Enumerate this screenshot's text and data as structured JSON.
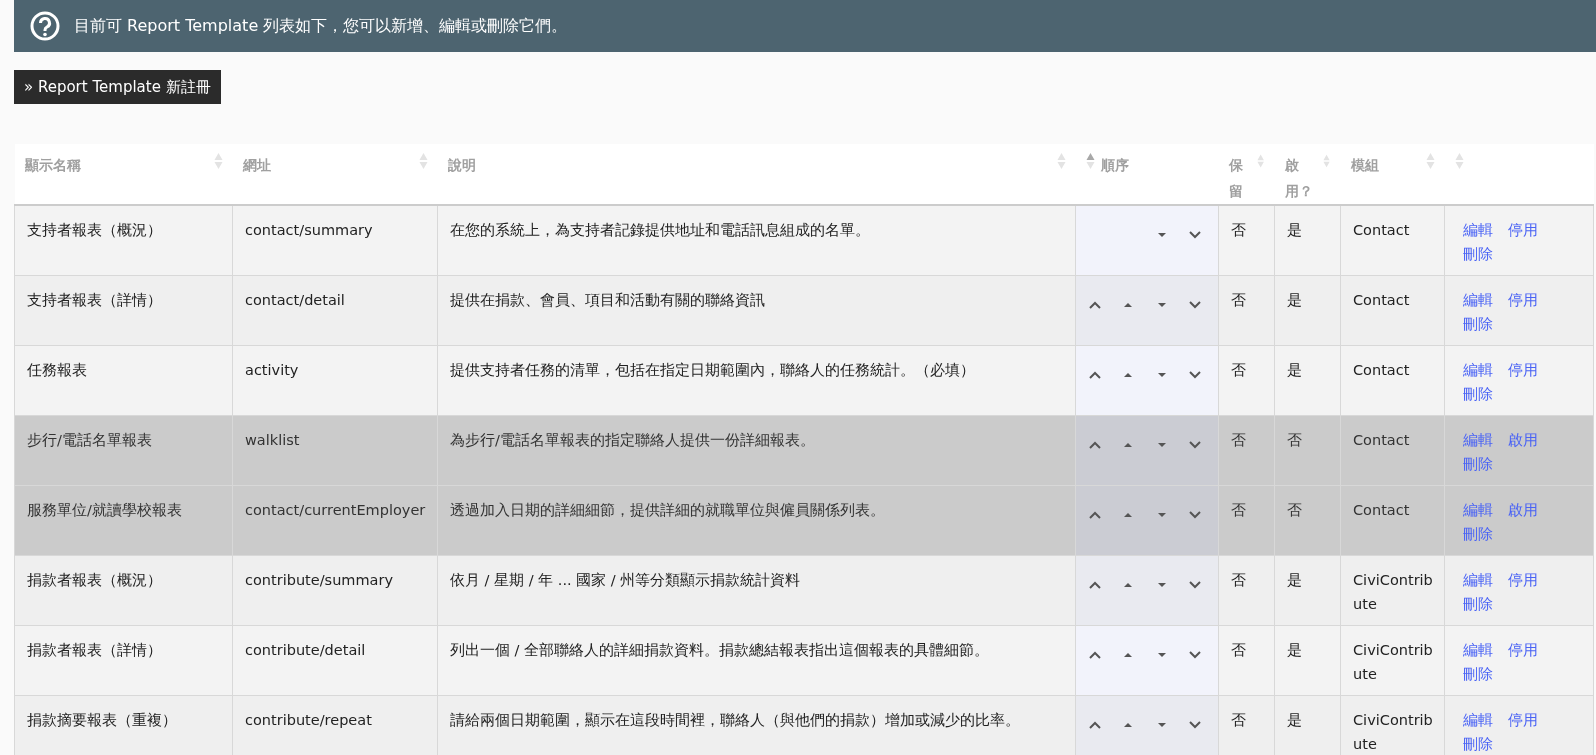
{
  "banner": {
    "text": "目前可 Report Template 列表如下，您可以新增、編輯或刪除它們。"
  },
  "new_button": {
    "label": "» Report Template 新註冊"
  },
  "table": {
    "columns": [
      {
        "label": "顯示名稱",
        "sorted": false
      },
      {
        "label": "網址",
        "sorted": false
      },
      {
        "label": "說明",
        "sorted": false
      },
      {
        "label": "順序",
        "sorted": true
      },
      {
        "label": "保留",
        "sorted": false
      },
      {
        "label": "啟用？",
        "sorted": false
      },
      {
        "label": "模組",
        "sorted": false
      },
      {
        "sorted": false
      }
    ],
    "rows": [
      {
        "name": "支持者報表（概況）",
        "url": "contact/summary",
        "description": "在您的系統上，為支持者記錄提供地址和電話訊息組成的名單。",
        "can_move_up": false,
        "can_move_down": true,
        "reserved": "否",
        "enabled_text": "是",
        "module": "Contact",
        "enabled": true,
        "actions": [
          {
            "label": "編輯"
          },
          {
            "label": "停用"
          },
          {
            "label": "刪除"
          }
        ]
      },
      {
        "name": "支持者報表（詳情）",
        "url": "contact/detail",
        "description": "提供在捐款、會員、項目和活動有關的聯絡資訊",
        "can_move_up": true,
        "can_move_down": true,
        "reserved": "否",
        "enabled_text": "是",
        "module": "Contact",
        "enabled": true,
        "actions": [
          {
            "label": "編輯"
          },
          {
            "label": "停用"
          },
          {
            "label": "刪除"
          }
        ]
      },
      {
        "name": "任務報表",
        "url": "activity",
        "description": "提供支持者任務的清單，包括在指定日期範圍內，聯絡人的任務統計。（必填）",
        "can_move_up": true,
        "can_move_down": true,
        "reserved": "否",
        "enabled_text": "是",
        "module": "Contact",
        "enabled": true,
        "actions": [
          {
            "label": "編輯"
          },
          {
            "label": "停用"
          },
          {
            "label": "刪除"
          }
        ]
      },
      {
        "name": "步行/電話名單報表",
        "url": "walklist",
        "description": "為步行/電話名單報表的指定聯絡人提供一份詳細報表。",
        "can_move_up": true,
        "can_move_down": true,
        "reserved": "否",
        "enabled_text": "否",
        "module": "Contact",
        "enabled": false,
        "actions": [
          {
            "label": "編輯"
          },
          {
            "label": "啟用"
          },
          {
            "label": "刪除"
          }
        ]
      },
      {
        "name": "服務單位/就讀學校報表",
        "url": "contact/currentEmployer",
        "description": "透過加入日期的詳細細節，提供詳細的就職單位與僱員關係列表。",
        "can_move_up": true,
        "can_move_down": true,
        "reserved": "否",
        "enabled_text": "否",
        "module": "Contact",
        "enabled": false,
        "actions": [
          {
            "label": "編輯"
          },
          {
            "label": "啟用"
          },
          {
            "label": "刪除"
          }
        ]
      },
      {
        "name": "捐款者報表（概況）",
        "url": "contribute/summary",
        "description": "依月 / 星期 / 年 ... 國家 / 州等分類顯示捐款統計資料",
        "can_move_up": true,
        "can_move_down": true,
        "reserved": "否",
        "enabled_text": "是",
        "module": "CiviContribute",
        "enabled": true,
        "actions": [
          {
            "label": "編輯"
          },
          {
            "label": "停用"
          },
          {
            "label": "刪除"
          }
        ]
      },
      {
        "name": "捐款者報表（詳情）",
        "url": "contribute/detail",
        "description": "列出一個 / 全部聯絡人的詳細捐款資料。捐款總結報表指出這個報表的具體細節。",
        "can_move_up": true,
        "can_move_down": true,
        "reserved": "否",
        "enabled_text": "是",
        "module": "CiviContribute",
        "enabled": true,
        "actions": [
          {
            "label": "編輯"
          },
          {
            "label": "停用"
          },
          {
            "label": "刪除"
          }
        ]
      },
      {
        "name": "捐款摘要報表（重複）",
        "url": "contribute/repeat",
        "description": "請給兩個日期範圍，顯示在這段時間裡，聯絡人（與他們的捐款）增加或減少的比率。",
        "can_move_up": true,
        "can_move_down": true,
        "reserved": "否",
        "enabled_text": "是",
        "module": "CiviContribute",
        "enabled": true,
        "actions": [
          {
            "label": "編輯"
          },
          {
            "label": "停用"
          },
          {
            "label": "刪除"
          }
        ]
      }
    ]
  }
}
